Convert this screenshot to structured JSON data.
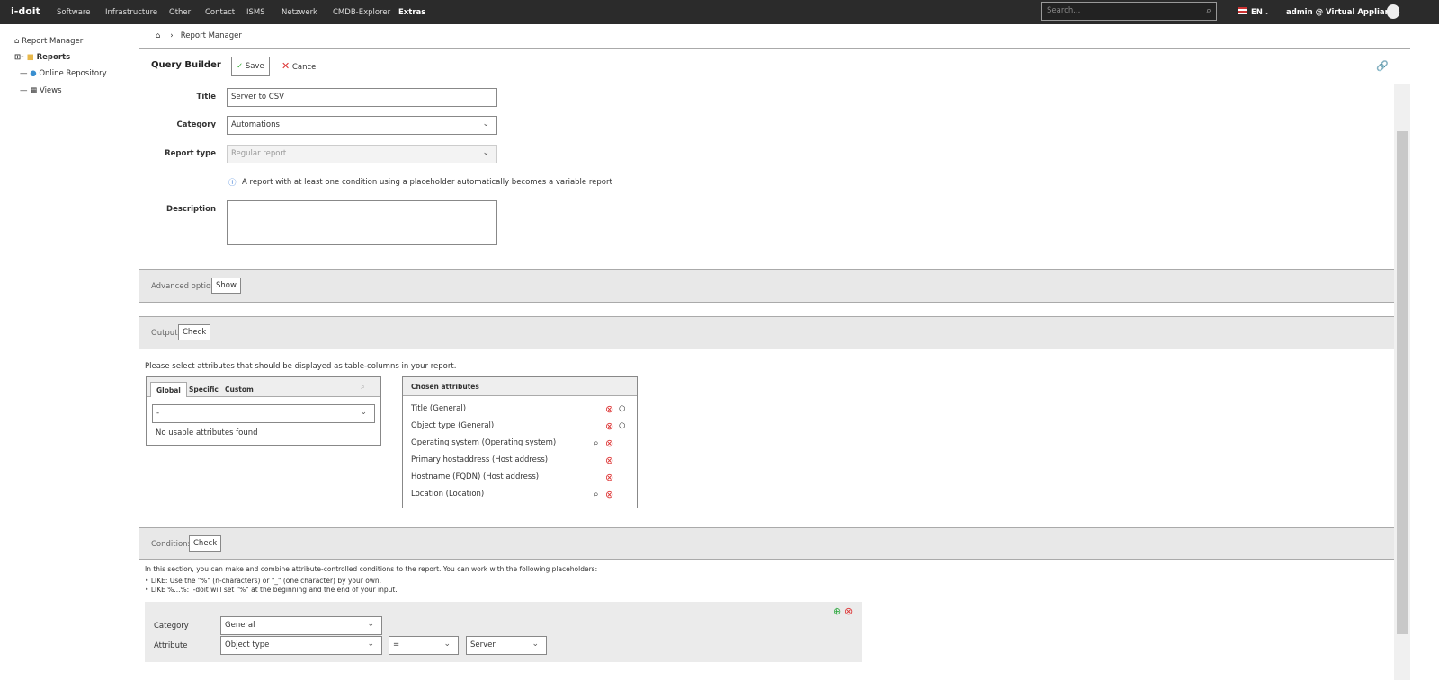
{
  "topbar": {
    "logo": "i-doit",
    "nav": [
      "Software",
      "Infrastructure",
      "Other",
      "Contact",
      "ISMS",
      "Netzwerk",
      "CMDB-Explorer",
      "Extras"
    ],
    "search_placeholder": "Search...",
    "language": "EN",
    "user": "admin @ Virtual Appliance"
  },
  "sidebar": {
    "items": [
      {
        "label": "Report Manager",
        "icon": "home-icon"
      },
      {
        "label": "Reports",
        "icon": "folder-icon"
      },
      {
        "label": "Online Repository",
        "icon": "globe-icon"
      },
      {
        "label": "Views",
        "icon": "table-icon"
      }
    ]
  },
  "breadcrumb": {
    "current": "Report Manager"
  },
  "header": {
    "title": "Query Builder",
    "save": "Save",
    "cancel": "Cancel"
  },
  "form": {
    "title_label": "Title",
    "title_value": "Server to CSV",
    "category_label": "Category",
    "category_value": "Automations",
    "report_type_label": "Report type",
    "report_type_value": "Regular report",
    "info": "A report with at least one condition using a placeholder automatically becomes a variable report",
    "description_label": "Description",
    "description_value": ""
  },
  "advanced": {
    "label": "Advanced options",
    "button": "Show"
  },
  "output": {
    "label": "Output",
    "button": "Check",
    "hint": "Please select attributes that should be displayed as table-columns in your report.",
    "tabs": [
      "Global",
      "Specific",
      "Custom"
    ],
    "select_value": "-",
    "empty": "No usable attributes found",
    "chosen_header": "Chosen attributes",
    "chosen": [
      "Title (General)",
      "Object type (General)",
      "Operating system (Operating system)",
      "Primary hostaddress (Host address)",
      "Hostname (FQDN) (Host address)",
      "Location (Location)"
    ]
  },
  "conditions": {
    "label": "Conditions",
    "button": "Check",
    "intro": "In this section, you can make and combine attribute-controlled conditions to the report. You can work with the following placeholders:",
    "bullets": [
      "LIKE: Use the \"%\" (n-characters) or \"_\" (one character) by your own.",
      "LIKE %...%: i-doit will set \"%\" at the beginning and the end of your input."
    ],
    "category_label": "Category",
    "category_value": "General",
    "attribute_label": "Attribute",
    "attribute_value": "Object type",
    "operator": "=",
    "value": "Server"
  },
  "colors": {
    "topbar": "#2b2b2b",
    "band": "#e8e8e8",
    "remove": "#dd3333",
    "add": "#33aa44"
  }
}
